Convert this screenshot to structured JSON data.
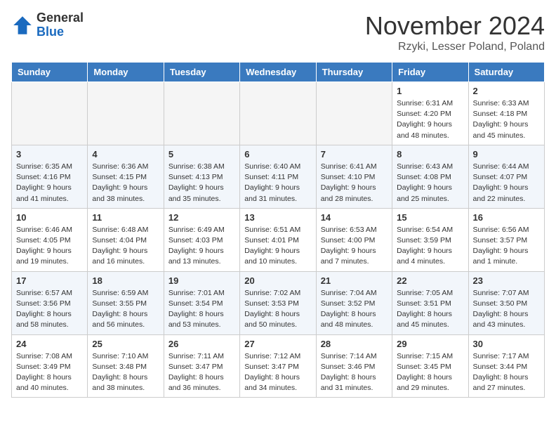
{
  "header": {
    "logo_general": "General",
    "logo_blue": "Blue",
    "month_title": "November 2024",
    "location": "Rzyki, Lesser Poland, Poland"
  },
  "calendar": {
    "days_of_week": [
      "Sunday",
      "Monday",
      "Tuesday",
      "Wednesday",
      "Thursday",
      "Friday",
      "Saturday"
    ],
    "weeks": [
      {
        "row_class": "row-odd",
        "days": [
          {
            "date": "",
            "info": ""
          },
          {
            "date": "",
            "info": ""
          },
          {
            "date": "",
            "info": ""
          },
          {
            "date": "",
            "info": ""
          },
          {
            "date": "",
            "info": ""
          },
          {
            "date": "1",
            "info": "Sunrise: 6:31 AM\nSunset: 4:20 PM\nDaylight: 9 hours and 48 minutes."
          },
          {
            "date": "2",
            "info": "Sunrise: 6:33 AM\nSunset: 4:18 PM\nDaylight: 9 hours and 45 minutes."
          }
        ]
      },
      {
        "row_class": "row-even",
        "days": [
          {
            "date": "3",
            "info": "Sunrise: 6:35 AM\nSunset: 4:16 PM\nDaylight: 9 hours and 41 minutes."
          },
          {
            "date": "4",
            "info": "Sunrise: 6:36 AM\nSunset: 4:15 PM\nDaylight: 9 hours and 38 minutes."
          },
          {
            "date": "5",
            "info": "Sunrise: 6:38 AM\nSunset: 4:13 PM\nDaylight: 9 hours and 35 minutes."
          },
          {
            "date": "6",
            "info": "Sunrise: 6:40 AM\nSunset: 4:11 PM\nDaylight: 9 hours and 31 minutes."
          },
          {
            "date": "7",
            "info": "Sunrise: 6:41 AM\nSunset: 4:10 PM\nDaylight: 9 hours and 28 minutes."
          },
          {
            "date": "8",
            "info": "Sunrise: 6:43 AM\nSunset: 4:08 PM\nDaylight: 9 hours and 25 minutes."
          },
          {
            "date": "9",
            "info": "Sunrise: 6:44 AM\nSunset: 4:07 PM\nDaylight: 9 hours and 22 minutes."
          }
        ]
      },
      {
        "row_class": "row-odd",
        "days": [
          {
            "date": "10",
            "info": "Sunrise: 6:46 AM\nSunset: 4:05 PM\nDaylight: 9 hours and 19 minutes."
          },
          {
            "date": "11",
            "info": "Sunrise: 6:48 AM\nSunset: 4:04 PM\nDaylight: 9 hours and 16 minutes."
          },
          {
            "date": "12",
            "info": "Sunrise: 6:49 AM\nSunset: 4:03 PM\nDaylight: 9 hours and 13 minutes."
          },
          {
            "date": "13",
            "info": "Sunrise: 6:51 AM\nSunset: 4:01 PM\nDaylight: 9 hours and 10 minutes."
          },
          {
            "date": "14",
            "info": "Sunrise: 6:53 AM\nSunset: 4:00 PM\nDaylight: 9 hours and 7 minutes."
          },
          {
            "date": "15",
            "info": "Sunrise: 6:54 AM\nSunset: 3:59 PM\nDaylight: 9 hours and 4 minutes."
          },
          {
            "date": "16",
            "info": "Sunrise: 6:56 AM\nSunset: 3:57 PM\nDaylight: 9 hours and 1 minute."
          }
        ]
      },
      {
        "row_class": "row-even",
        "days": [
          {
            "date": "17",
            "info": "Sunrise: 6:57 AM\nSunset: 3:56 PM\nDaylight: 8 hours and 58 minutes."
          },
          {
            "date": "18",
            "info": "Sunrise: 6:59 AM\nSunset: 3:55 PM\nDaylight: 8 hours and 56 minutes."
          },
          {
            "date": "19",
            "info": "Sunrise: 7:01 AM\nSunset: 3:54 PM\nDaylight: 8 hours and 53 minutes."
          },
          {
            "date": "20",
            "info": "Sunrise: 7:02 AM\nSunset: 3:53 PM\nDaylight: 8 hours and 50 minutes."
          },
          {
            "date": "21",
            "info": "Sunrise: 7:04 AM\nSunset: 3:52 PM\nDaylight: 8 hours and 48 minutes."
          },
          {
            "date": "22",
            "info": "Sunrise: 7:05 AM\nSunset: 3:51 PM\nDaylight: 8 hours and 45 minutes."
          },
          {
            "date": "23",
            "info": "Sunrise: 7:07 AM\nSunset: 3:50 PM\nDaylight: 8 hours and 43 minutes."
          }
        ]
      },
      {
        "row_class": "row-odd",
        "days": [
          {
            "date": "24",
            "info": "Sunrise: 7:08 AM\nSunset: 3:49 PM\nDaylight: 8 hours and 40 minutes."
          },
          {
            "date": "25",
            "info": "Sunrise: 7:10 AM\nSunset: 3:48 PM\nDaylight: 8 hours and 38 minutes."
          },
          {
            "date": "26",
            "info": "Sunrise: 7:11 AM\nSunset: 3:47 PM\nDaylight: 8 hours and 36 minutes."
          },
          {
            "date": "27",
            "info": "Sunrise: 7:12 AM\nSunset: 3:47 PM\nDaylight: 8 hours and 34 minutes."
          },
          {
            "date": "28",
            "info": "Sunrise: 7:14 AM\nSunset: 3:46 PM\nDaylight: 8 hours and 31 minutes."
          },
          {
            "date": "29",
            "info": "Sunrise: 7:15 AM\nSunset: 3:45 PM\nDaylight: 8 hours and 29 minutes."
          },
          {
            "date": "30",
            "info": "Sunrise: 7:17 AM\nSunset: 3:44 PM\nDaylight: 8 hours and 27 minutes."
          }
        ]
      }
    ]
  }
}
